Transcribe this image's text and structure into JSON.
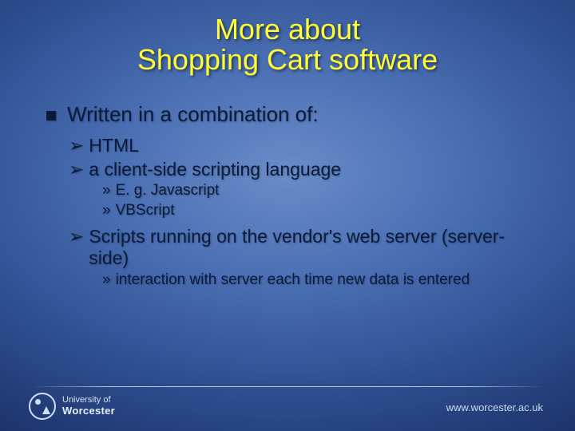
{
  "title_line1": "More about",
  "title_line2": "Shopping Cart software",
  "bullets": {
    "l1_0": "Written in a combination of:",
    "l2_0": "HTML",
    "l2_1": "a client-side scripting language",
    "l3_0": "E. g. Javascript",
    "l3_1": "VBScript",
    "l2_2": "Scripts running on the vendor's web server (server-side)",
    "l3_2": "interaction with server each time new data is entered"
  },
  "glyphs": {
    "arrow": "➢",
    "raquo": "»"
  },
  "footer": {
    "uni_line1": "University of",
    "uni_line2": "Worcester",
    "url": "www.worcester.ac.uk"
  }
}
